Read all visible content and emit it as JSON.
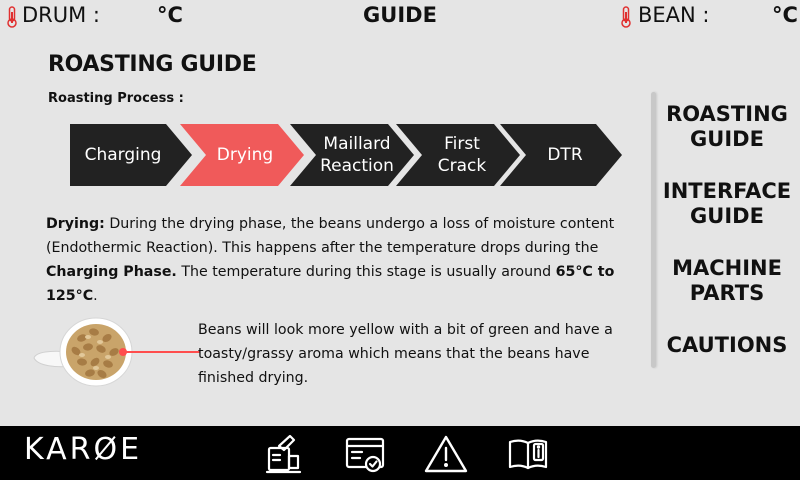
{
  "header": {
    "drum_label": "DRUM :",
    "drum_unit": "°C",
    "title": "GUIDE",
    "bean_label": "BEAN :",
    "bean_unit": "°C"
  },
  "main": {
    "title": "ROASTING GUIDE",
    "subtitle": "Roasting Process :",
    "steps": [
      {
        "line1": "Charging",
        "line2": ""
      },
      {
        "line1": "Drying",
        "line2": ""
      },
      {
        "line1": "Maillard",
        "line2": "Reaction"
      },
      {
        "line1": "First",
        "line2": "Crack"
      },
      {
        "line1": "DTR",
        "line2": ""
      }
    ],
    "active_step_color": "#f05a5a",
    "step_color": "#222222",
    "description": {
      "term": "Drying:",
      "text1": " During the drying phase, the beans undergo a loss of moisture content (Endothermic Reaction). This happens after the temperature drops during the ",
      "phase": "Charging Phase.",
      "text2": " The temperature during this stage is usually around ",
      "range": "65°C to 125°C",
      "end": "."
    },
    "bean_note": "Beans will look more yellow with a bit of green and have a toasty/grassy aroma which means that the beans have finished drying."
  },
  "menu": {
    "items": [
      {
        "line1": "ROASTING",
        "line2": "GUIDE"
      },
      {
        "line1": "INTERFACE",
        "line2": "GUIDE"
      },
      {
        "line1": "MACHINE",
        "line2": "PARTS"
      },
      {
        "line1": "CAUTIONS",
        "line2": ""
      }
    ]
  },
  "footer": {
    "brand": "KARØE",
    "icons": [
      "roast-profile-icon",
      "settings-panel-icon",
      "warning-icon",
      "manual-book-icon"
    ]
  }
}
